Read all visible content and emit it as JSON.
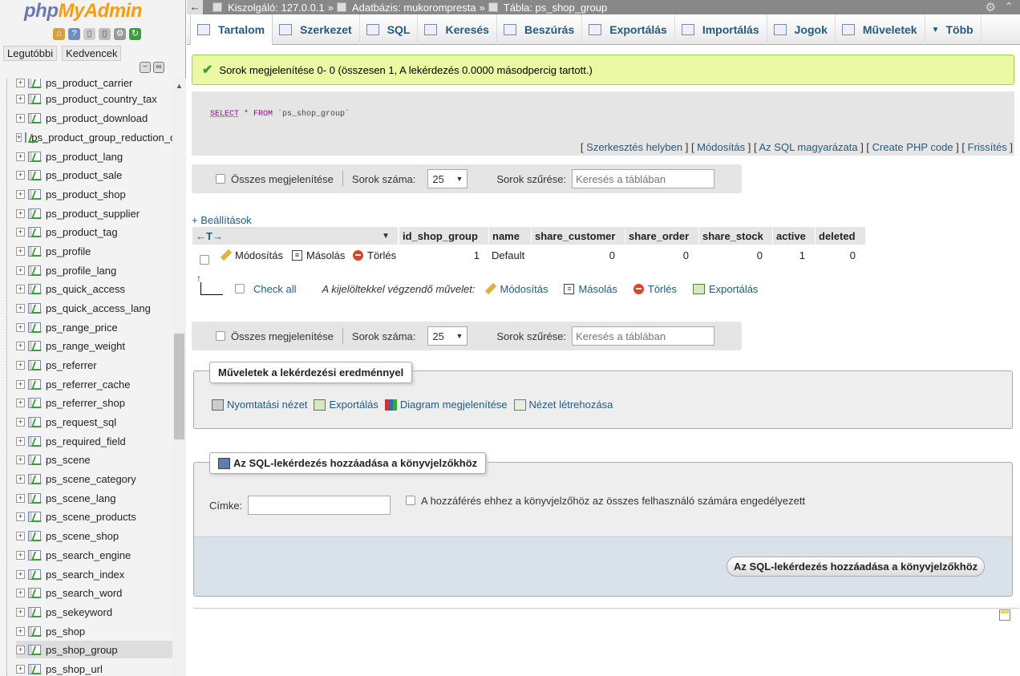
{
  "sidebar": {
    "logo_php": "php",
    "logo_myadmin": "MyAdmin",
    "tabs": [
      "Legutóbbi",
      "Kedvencek"
    ],
    "tables": [
      "ps_product_carrier",
      "ps_product_country_tax",
      "ps_product_download",
      "ps_product_group_reduction_cache",
      "ps_product_lang",
      "ps_product_sale",
      "ps_product_shop",
      "ps_product_supplier",
      "ps_product_tag",
      "ps_profile",
      "ps_profile_lang",
      "ps_quick_access",
      "ps_quick_access_lang",
      "ps_range_price",
      "ps_range_weight",
      "ps_referrer",
      "ps_referrer_cache",
      "ps_referrer_shop",
      "ps_request_sql",
      "ps_required_field",
      "ps_scene",
      "ps_scene_category",
      "ps_scene_lang",
      "ps_scene_products",
      "ps_scene_shop",
      "ps_search_engine",
      "ps_search_index",
      "ps_search_word",
      "ps_sekeyword",
      "ps_shop",
      "ps_shop_group",
      "ps_shop_url"
    ],
    "active_table": "ps_shop_group"
  },
  "breadcrumb": {
    "back": "←",
    "server": "Kiszolgáló: 127.0.0.1",
    "database": "Adatbázis: mukorompresta",
    "table": "Tábla: ps_shop_group",
    "sep": "»"
  },
  "tabs": [
    "Tartalom",
    "Szerkezet",
    "SQL",
    "Keresés",
    "Beszúrás",
    "Exportálás",
    "Importálás",
    "Jogok",
    "Műveletek",
    "Több"
  ],
  "success_message": "Sorok megjelenítése 0- 0 (összesen 1, A lekérdezés 0.0000 másodpercig tartott.)",
  "sql": {
    "select": "SELECT",
    "star": " * ",
    "from": "FROM",
    "table": " `ps_shop_group`",
    "links": [
      "Szerkesztés helyben",
      "Módosítás",
      "Az SQL magyarázata",
      "Create PHP code",
      "Frissítés"
    ]
  },
  "navbar": {
    "show_all": "Összes megjelenítése",
    "row_count_label": "Sorok száma:",
    "row_count_value": "25",
    "filter_label": "Sorok szűrése:",
    "filter_placeholder": "Keresés a táblában"
  },
  "settings_link": "+ Beállítások",
  "table": {
    "headers": [
      "id_shop_group",
      "name",
      "share_customer",
      "share_order",
      "share_stock",
      "active",
      "deleted"
    ],
    "rows": [
      {
        "id_shop_group": "1",
        "name": "Default",
        "share_customer": "0",
        "share_order": "0",
        "share_stock": "0",
        "active": "1",
        "deleted": "0"
      }
    ],
    "row_actions": {
      "edit": "Módosítás",
      "copy": "Másolás",
      "delete": "Törlés"
    },
    "sort_arrows": "←T→"
  },
  "bulk": {
    "check_all": "Check all",
    "label": "A kijelöltekkel végzendő művelet:",
    "edit": "Módosítás",
    "copy": "Másolás",
    "delete": "Törlés",
    "export": "Exportálás"
  },
  "query_ops": {
    "legend": "Műveletek a lekérdezési eredménnyel",
    "links": [
      "Nyomtatási nézet",
      "Exportálás",
      "Diagram megjelenítése",
      "Nézet létrehozása"
    ]
  },
  "bookmark": {
    "legend": "Az SQL-lekérdezés hozzáadása a könyvjelzőkhöz",
    "label_field": "Címke:",
    "public_checkbox": "A hozzáférés ehhez a könyvjelzőhöz az összes felhasználó számára engedélyezett",
    "submit": "Az SQL-lekérdezés hozzáadása a könyvjelzőkhöz"
  },
  "colors": {
    "link": "#235a81",
    "success_bg": "#ebf8a4",
    "logo_php": "#6c78af",
    "logo_myadmin": "#f89c0e"
  }
}
